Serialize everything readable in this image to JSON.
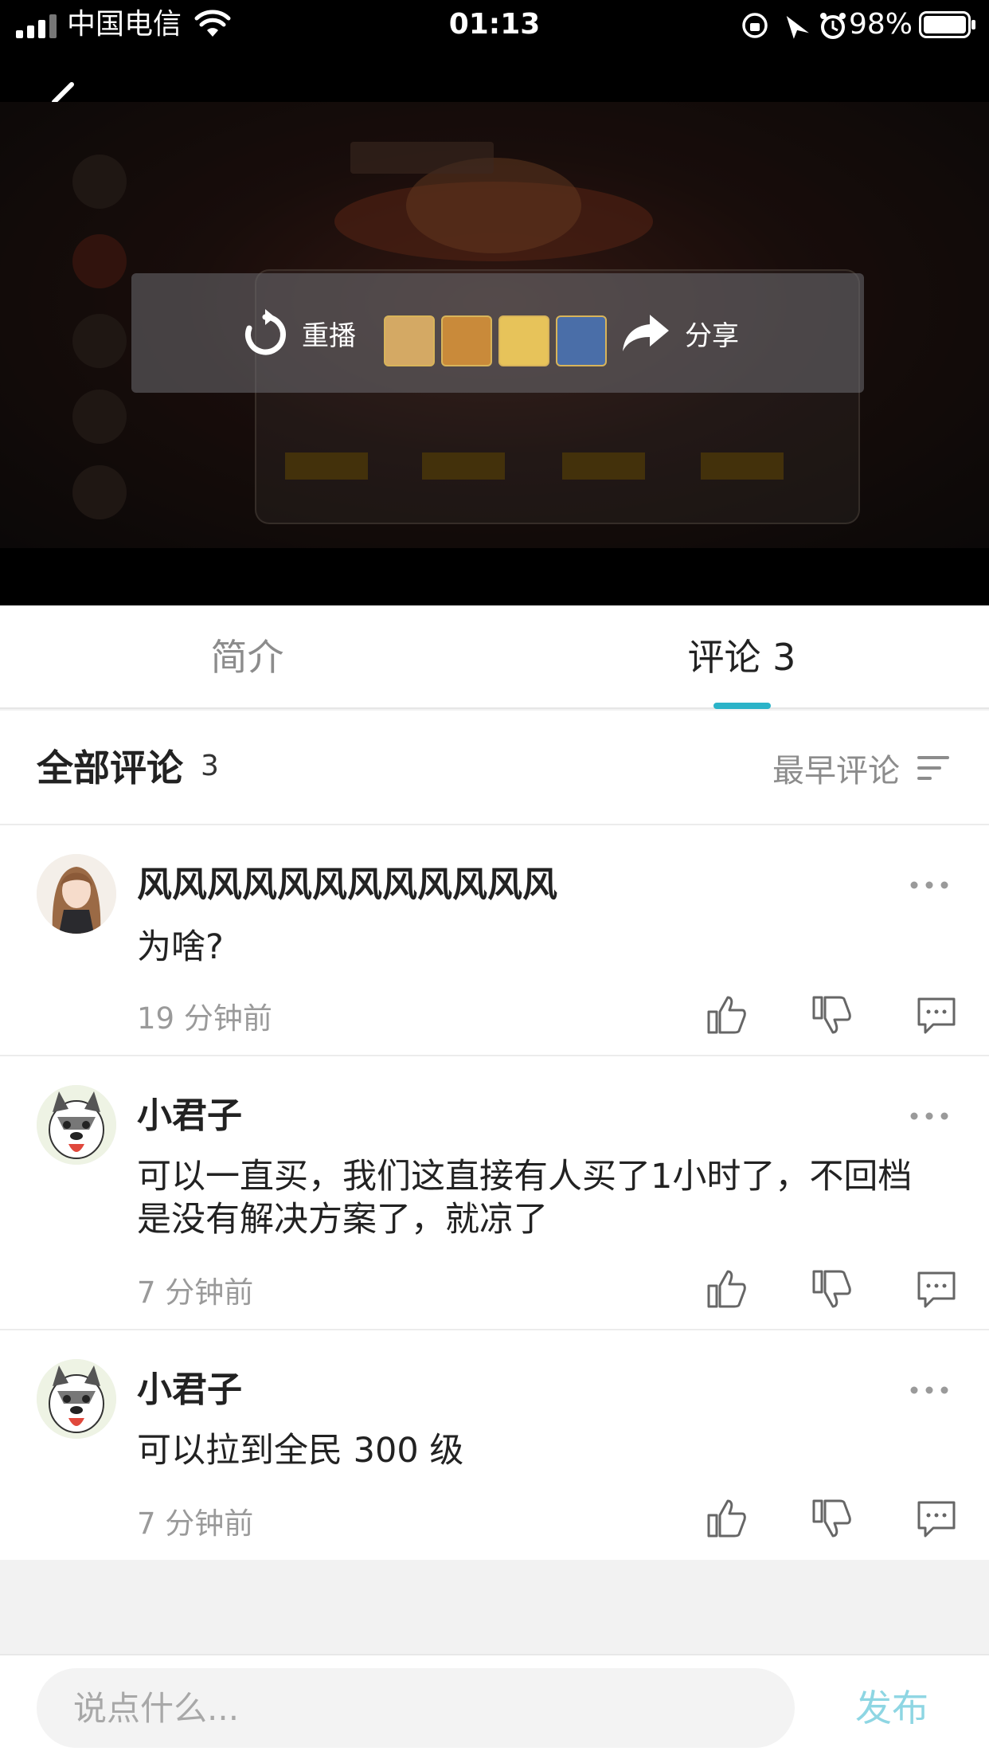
{
  "status_bar": {
    "carrier": "中国电信",
    "time": "01:13",
    "battery": "98%"
  },
  "video": {
    "replay_label": "重播",
    "share_label": "分享"
  },
  "tabs": [
    {
      "label": "简介",
      "active": false
    },
    {
      "label": "评论 3",
      "active": true
    }
  ],
  "comments_header": {
    "title": "全部评论",
    "count": "3",
    "sort_label": "最早评论"
  },
  "comments": [
    {
      "name": "风风风风风风风风风风风风",
      "text": "为啥?",
      "time": "19 分钟前",
      "avatar": "anime-girl-avatar"
    },
    {
      "name": "小君子",
      "text": "可以一直买，我们这直接有人买了1小时了，不回档是没有解决方案了，就凉了",
      "time": "7 分钟前",
      "avatar": "husky-avatar"
    },
    {
      "name": "小君子",
      "text": "可以拉到全民 300 级",
      "time": "7 分钟前",
      "avatar": "husky-avatar"
    }
  ],
  "bottom": {
    "placeholder": "说点什么...",
    "publish_label": "发布"
  },
  "colors": {
    "accent": "#2bb3c8",
    "publish": "#8ed6e3"
  }
}
